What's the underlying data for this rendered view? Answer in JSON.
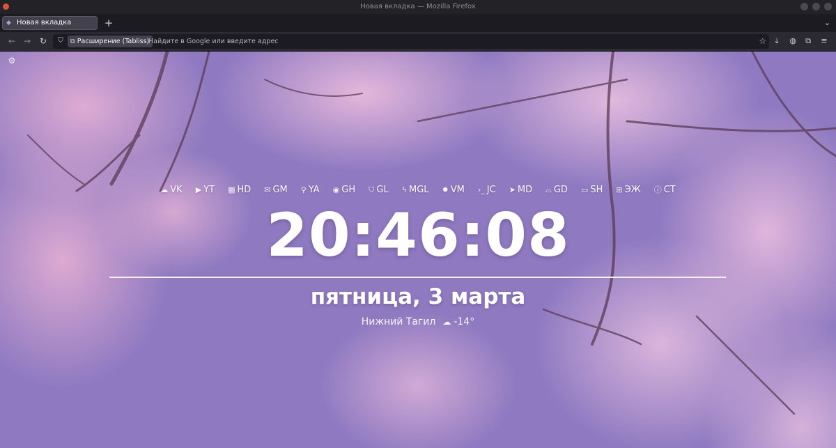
{
  "window": {
    "title": "Новая вкладка — Mozilla Firefox"
  },
  "tabs": [
    {
      "label": "Новая вкладка",
      "active": true
    }
  ],
  "navbar": {
    "back_icon": "arrow-left-icon",
    "forward_icon": "arrow-right-icon",
    "reload_icon": "reload-icon",
    "extension_chip": "Расширение (Tabliss)",
    "url_placeholder": "Найдите в Google или введите адрес"
  },
  "links": [
    {
      "label": "VK",
      "icon": "cloud-icon",
      "glyph": "☁"
    },
    {
      "label": "YT",
      "icon": "youtube-icon",
      "glyph": "▶"
    },
    {
      "label": "HD",
      "icon": "film-icon",
      "glyph": "▦"
    },
    {
      "label": "GM",
      "icon": "mail-icon",
      "glyph": "✉"
    },
    {
      "label": "YA",
      "icon": "search-icon",
      "glyph": "⚲"
    },
    {
      "label": "GH",
      "icon": "github-icon",
      "glyph": "◉"
    },
    {
      "label": "GL",
      "icon": "gitlab-icon",
      "glyph": "⛉"
    },
    {
      "label": "MGL",
      "icon": "zap-icon",
      "glyph": "ϟ"
    },
    {
      "label": "VM",
      "icon": "cpu-icon",
      "glyph": "✹"
    },
    {
      "label": "JC",
      "icon": "terminal-icon",
      "glyph": "›_"
    },
    {
      "label": "MD",
      "icon": "navigation-icon",
      "glyph": "➤"
    },
    {
      "label": "GD",
      "icon": "hard-drive-icon",
      "glyph": "⌓"
    },
    {
      "label": "SH",
      "icon": "clipboard-icon",
      "glyph": "▭"
    },
    {
      "label": "ЭЖ",
      "icon": "book-open-icon",
      "glyph": "⊞"
    },
    {
      "label": "CT",
      "icon": "info-icon",
      "glyph": "ⓘ"
    }
  ],
  "clock": "20:46:08",
  "date": "пятница, 3 марта",
  "weather": {
    "city": "Нижний Тагил",
    "icon": "cloud-icon",
    "temperature": "-14°"
  },
  "colors": {
    "background": "#8f7ac1",
    "blossom": "#ecb4d6",
    "chrome": "#2b2a33"
  }
}
